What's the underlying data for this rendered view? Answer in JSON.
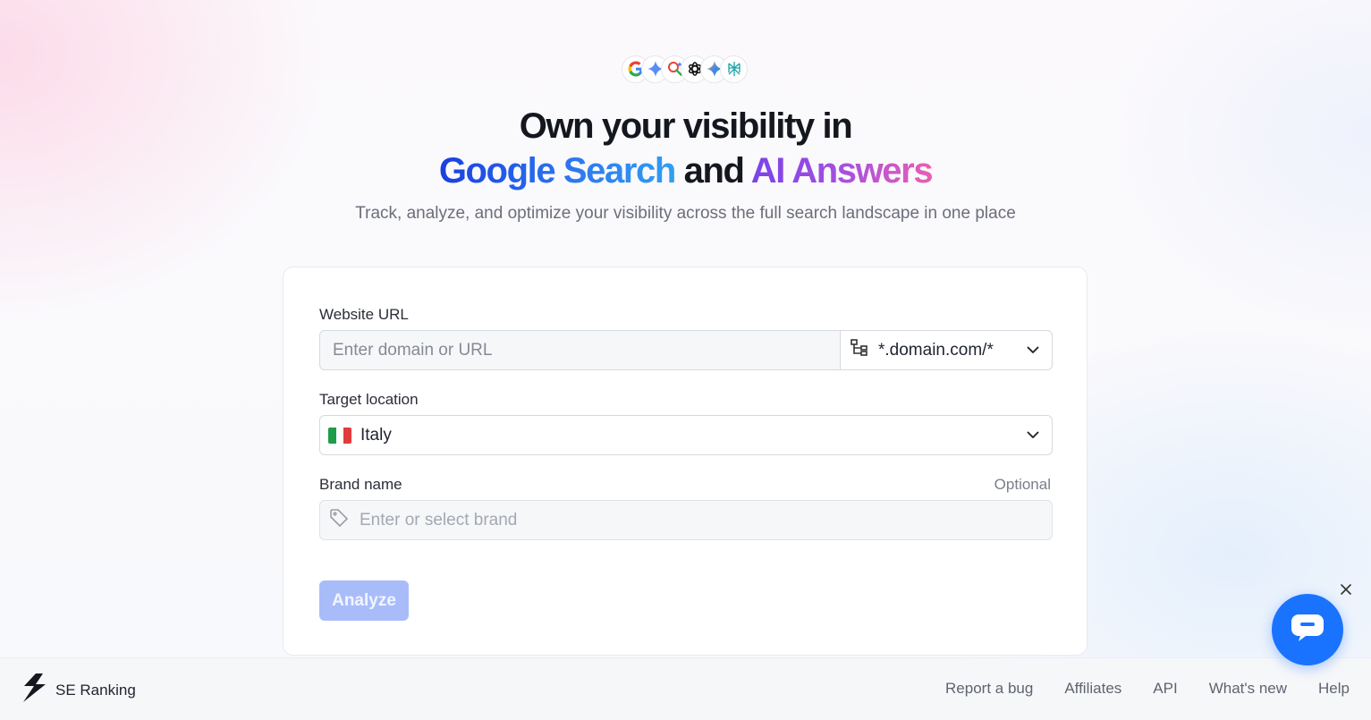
{
  "engines": [
    {
      "name": "google-icon"
    },
    {
      "name": "gemini-icon"
    },
    {
      "name": "google-ai-mode-icon"
    },
    {
      "name": "chatgpt-icon"
    },
    {
      "name": "gemini-alt-icon"
    },
    {
      "name": "perplexity-icon"
    }
  ],
  "hero": {
    "line1": "Own your visibility in",
    "highlight1": "Google Search",
    "connector": "and",
    "highlight2": "AI Answers",
    "subtitle": "Track, analyze, and optimize your visibility across the full search landscape in one place"
  },
  "form": {
    "website_label": "Website URL",
    "website_placeholder": "Enter domain or URL",
    "scope_value": "*.domain.com/*",
    "location_label": "Target location",
    "location_value": "Italy",
    "brand_label": "Brand name",
    "brand_optional": "Optional",
    "brand_placeholder": "Enter or select brand",
    "analyze_label": "Analyze"
  },
  "footer": {
    "logo_text": "SE Ranking",
    "links": [
      "Report a bug",
      "Affiliates",
      "API",
      "What's new",
      "Help"
    ]
  },
  "colors": {
    "accent": "#1a73ff",
    "button_disabled": "#a9bcfa"
  }
}
